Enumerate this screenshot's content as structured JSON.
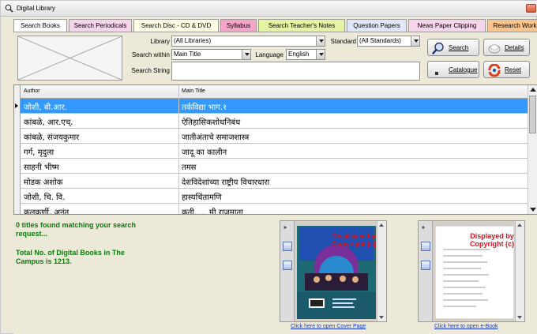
{
  "window": {
    "title": "Digital Library",
    "icon": "search-icon"
  },
  "tabs": [
    {
      "label": "Search Books",
      "bg": "#ffffff",
      "active": true
    },
    {
      "label": "Search Periodicals",
      "bg": "#f6d4e9"
    },
    {
      "label": "Search Disc - CD & DVD",
      "bg": "#ffffe6"
    },
    {
      "label": "Syllabus",
      "bg": "#f7a4c8"
    },
    {
      "label": "Search Teacher's Notes",
      "bg": "#e5f4a3"
    },
    {
      "label": "Question Papers",
      "bg": "#dfe8fb"
    },
    {
      "label": "News Paper Clipping",
      "bg": "#f6d4e9"
    },
    {
      "label": "Research Work",
      "bg": "#fbc48c"
    }
  ],
  "search": {
    "library_label": "Library",
    "library_value": "(All Libraries)",
    "standard_label": "Standard",
    "standard_value": "(All Standards)",
    "within_label": "Search within",
    "within_value": "Main Title",
    "language_label": "Language",
    "language_value": "English",
    "string_label": "Search String",
    "string_value": ""
  },
  "buttons": {
    "search": "Search",
    "details": "Details",
    "catalogue": "Catalogue",
    "reset": "Reset"
  },
  "grid": {
    "col_author": "Author",
    "col_title": "Main Title",
    "rows": [
      {
        "author": "जोशी, बी.आर.",
        "title": "तर्कविद्या भाग.१"
      },
      {
        "author": "कांबळे, आर.एच्.",
        "title": "ऐतिहासिकशोधनिबंध"
      },
      {
        "author": "कांबळे, संजयकुमार",
        "title": "जातीअंताचे समाजशास्त्र"
      },
      {
        "author": "गर्ग, मृदुला",
        "title": "जादू का कालीन"
      },
      {
        "author": "साहनी भीष्म",
        "title": "तमस"
      },
      {
        "author": "मोडक अशोक",
        "title": "देशविदेशांच्या राष्ट्रीय विचारधारा"
      },
      {
        "author": "जोशी, चि. वि.",
        "title": "हास्यचिंतामणि"
      },
      {
        "author": "कुलकर्णी, अनंत",
        "title": "कृती..... मी राजमाता"
      }
    ],
    "selected_row": 0
  },
  "status": {
    "found": "0 titles found matching your search request...",
    "total": "Total No. of Digital Books in The Campus is 1213."
  },
  "viewers": {
    "watermark_line1": "Displayed by",
    "watermark_line2": "Copyright (c)",
    "cover_link": "Click here to open Cover Page",
    "ebook_link": "Click here to open e-Book"
  },
  "colors": {
    "status_green": "#0c7a0c",
    "selection_blue": "#3399ff",
    "watermark_red": "#e0101a",
    "link_blue": "#1a3cc8"
  }
}
